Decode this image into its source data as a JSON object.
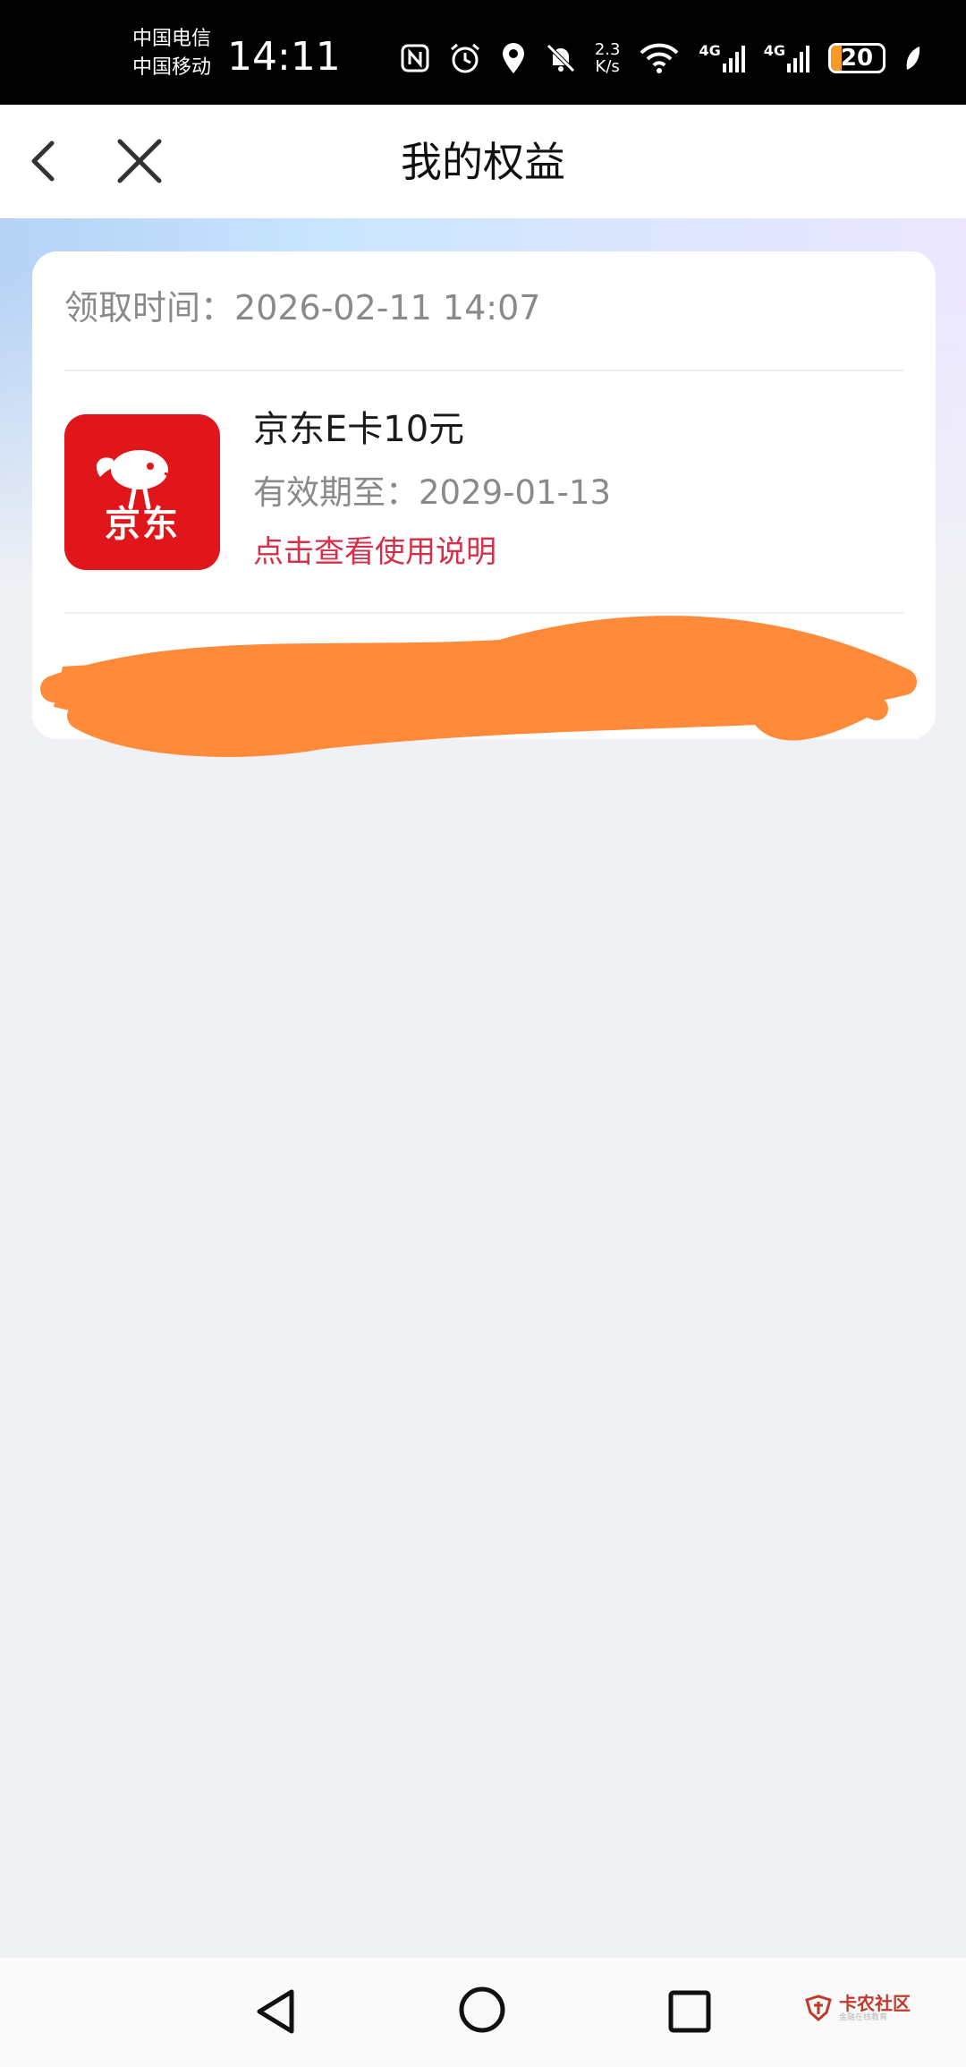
{
  "status_bar": {
    "carrier_1": "中国电信",
    "carrier_2": "中国移动",
    "time": "14:11",
    "net_speed_value": "2.3",
    "net_speed_unit": "K/s",
    "network_1": "4G",
    "network_2": "4G",
    "battery": "20"
  },
  "header": {
    "title": "我的权益",
    "back_icon": "chevron-left-icon",
    "close_icon": "close-icon"
  },
  "card": {
    "claim_label": "领取时间：",
    "claim_time": "2026-02-11 14:07",
    "logo_text": "京东",
    "item_name": "京东E卡10元",
    "expiry_label": "有效期至：",
    "expiry_date": "2029-01-13",
    "usage_link": "点击查看使用说明"
  },
  "bottom_nav": {
    "watermark_title": "卡农社区",
    "watermark_sub": "金融在线教育"
  },
  "colors": {
    "link": "#d5304b",
    "logo_red": "#e0161b",
    "scribble_orange": "#ff8a3a"
  }
}
